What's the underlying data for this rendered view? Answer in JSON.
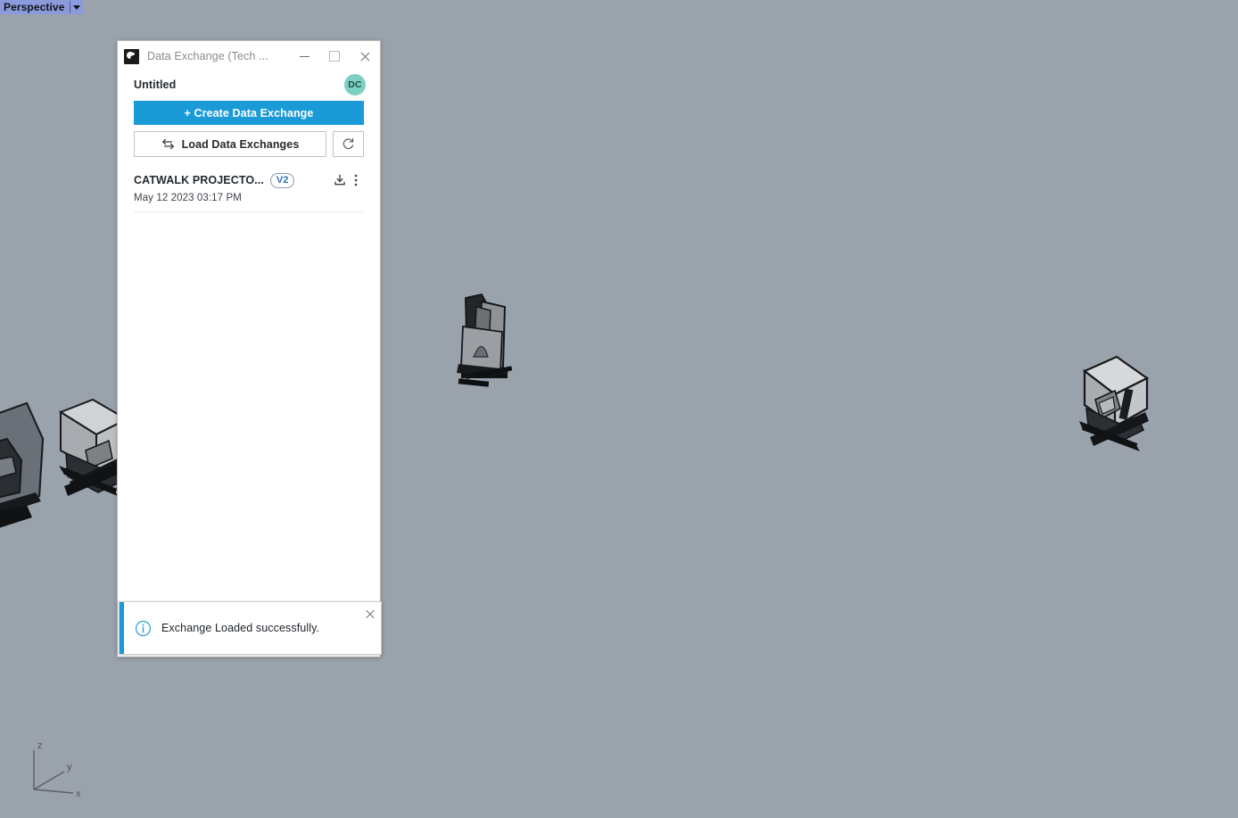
{
  "viewport": {
    "view_label": "Perspective",
    "background_color": "#9aa3ac",
    "axis_labels": {
      "x": "x",
      "y": "y",
      "z": "z"
    },
    "models": [
      {
        "name": "projector-left-edge",
        "tone": "dark"
      },
      {
        "name": "projector-left",
        "tone": "light"
      },
      {
        "name": "projector-center",
        "tone": "dark"
      },
      {
        "name": "projector-right",
        "tone": "light"
      }
    ]
  },
  "panel": {
    "titlebar": {
      "icon": "app-logo-icon",
      "title": "Data Exchange (Tech ...",
      "minimize_label": "minimize-icon",
      "maximize_label": "maximize-icon",
      "close_label": "close-icon"
    },
    "header": {
      "document_title": "Untitled",
      "avatar_initials": "DC",
      "avatar_color": "#7ed0c4"
    },
    "actions": {
      "create_label": "+ Create Data Exchange",
      "create_color": "#1a9ad7",
      "load_label": "Load Data Exchanges",
      "load_icon": "swap-arrows-icon",
      "refresh_icon": "refresh-icon"
    },
    "exchanges": [
      {
        "name": "CATWALK PROJECTO...",
        "version": "V2",
        "date": "May 12 2023 03:17 PM",
        "download_icon": "download-icon",
        "menu_icon": "kebab-menu-icon"
      }
    ],
    "toast": {
      "icon": "info-icon",
      "message": "Exchange Loaded successfully.",
      "accent_color": "#1a9ad7",
      "close_icon": "close-icon"
    }
  }
}
